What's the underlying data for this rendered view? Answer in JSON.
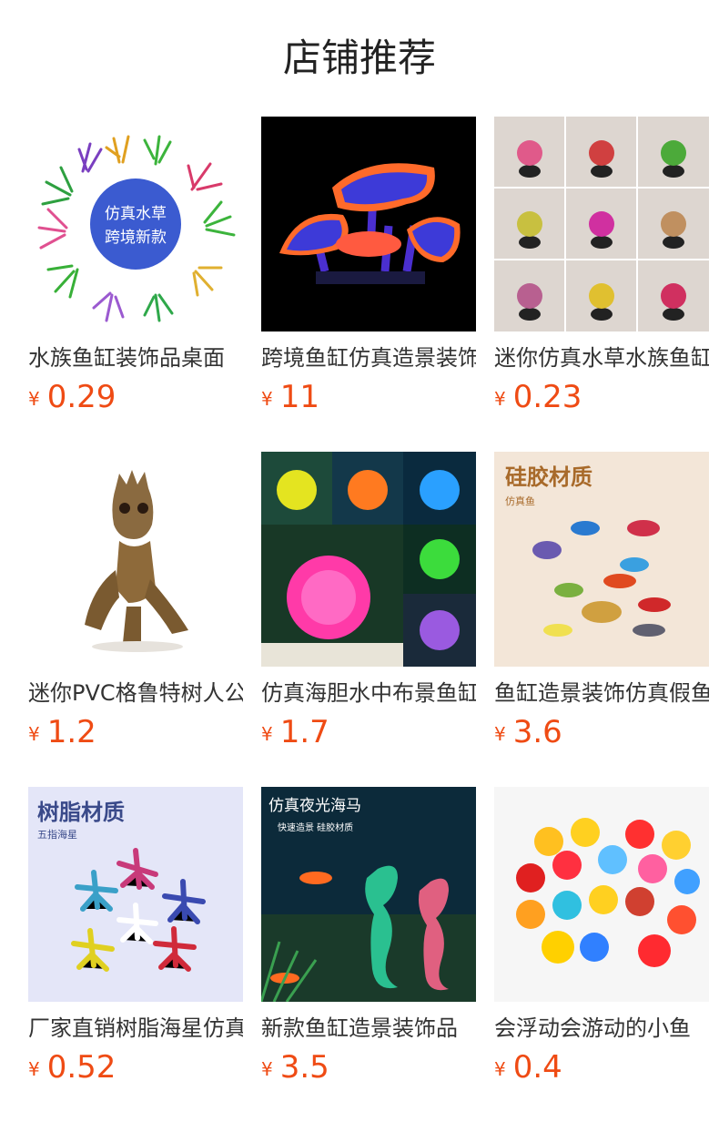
{
  "header": {
    "title": "店铺推荐"
  },
  "currency": "¥",
  "colors": {
    "price": "#ef4b14",
    "title": "#222222"
  },
  "products": [
    {
      "name": "水族鱼缸装饰品桌面",
      "price": "0.29",
      "image": {
        "kind": "plant-circle",
        "overlay_lines": [
          "仿真水草",
          "跨境新款"
        ]
      }
    },
    {
      "name": "跨境鱼缸仿真造景装饰",
      "price": "11",
      "image": {
        "kind": "glow-mushroom"
      }
    },
    {
      "name": "迷你仿真水草水族鱼缸",
      "price": "0.23",
      "image": {
        "kind": "plant-grid"
      }
    },
    {
      "name": "迷你PVC格鲁特树人公仔",
      "price": "1.2",
      "image": {
        "kind": "tree-figure"
      }
    },
    {
      "name": "仿真海胆水中布景鱼缸",
      "price": "1.7",
      "image": {
        "kind": "sea-urchin-collage"
      }
    },
    {
      "name": "鱼缸造景装饰仿真假鱼",
      "price": "3.6",
      "image": {
        "kind": "silicone-fish",
        "overlay_lines": [
          "硅胶材质",
          "仿真鱼"
        ]
      }
    },
    {
      "name": "厂家直销树脂海星仿真",
      "price": "0.52",
      "image": {
        "kind": "starfish",
        "overlay_lines": [
          "树脂材质",
          "五指海星"
        ]
      }
    },
    {
      "name": "新款鱼缸造景装饰品",
      "price": "3.5",
      "image": {
        "kind": "glow-seahorse",
        "overlay_lines": [
          "仿真夜光海马",
          "快速造景  硅胶材质"
        ]
      }
    },
    {
      "name": "会浮动会游动的小鱼",
      "price": "0.4",
      "image": {
        "kind": "floating-fish"
      }
    }
  ]
}
